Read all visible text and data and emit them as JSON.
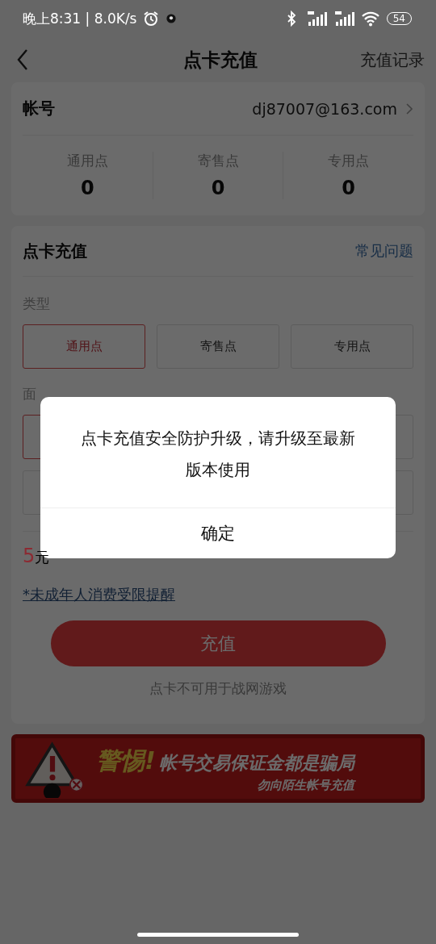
{
  "status_bar": {
    "time": "晚上8:31 | 8.0K/s",
    "battery": "54"
  },
  "nav": {
    "title": "点卡充值",
    "action": "充值记录"
  },
  "account": {
    "label": "帐号",
    "value": "dj87007@163.com",
    "points": [
      {
        "label": "通用点",
        "value": "0"
      },
      {
        "label": "寄售点",
        "value": "0"
      },
      {
        "label": "专用点",
        "value": "0"
      }
    ]
  },
  "recharge": {
    "title": "点卡充值",
    "help_link": "常见问题",
    "type_label": "类型",
    "types": [
      {
        "label": "通用点",
        "selected": true
      },
      {
        "label": "寄售点",
        "selected": false
      },
      {
        "label": "专用点",
        "selected": false
      }
    ],
    "denomination_label": "面",
    "denominations": [
      {
        "selected": true
      },
      {
        "selected": false
      },
      {
        "selected": false
      },
      {
        "selected": false
      }
    ],
    "amount": "5",
    "currency": "元",
    "minor_notice_link": "*未成年人消费受限提醒",
    "submit": "充值",
    "note": "点卡不可用于战网游戏"
  },
  "banner": {
    "headline": "警惕!",
    "text": "帐号交易保证金都是骗局",
    "subtext": "勿向陌生帐号充值"
  },
  "dialog": {
    "message": "点卡充值安全防护升级，请升级至最新版本使用",
    "confirm": "确定"
  }
}
